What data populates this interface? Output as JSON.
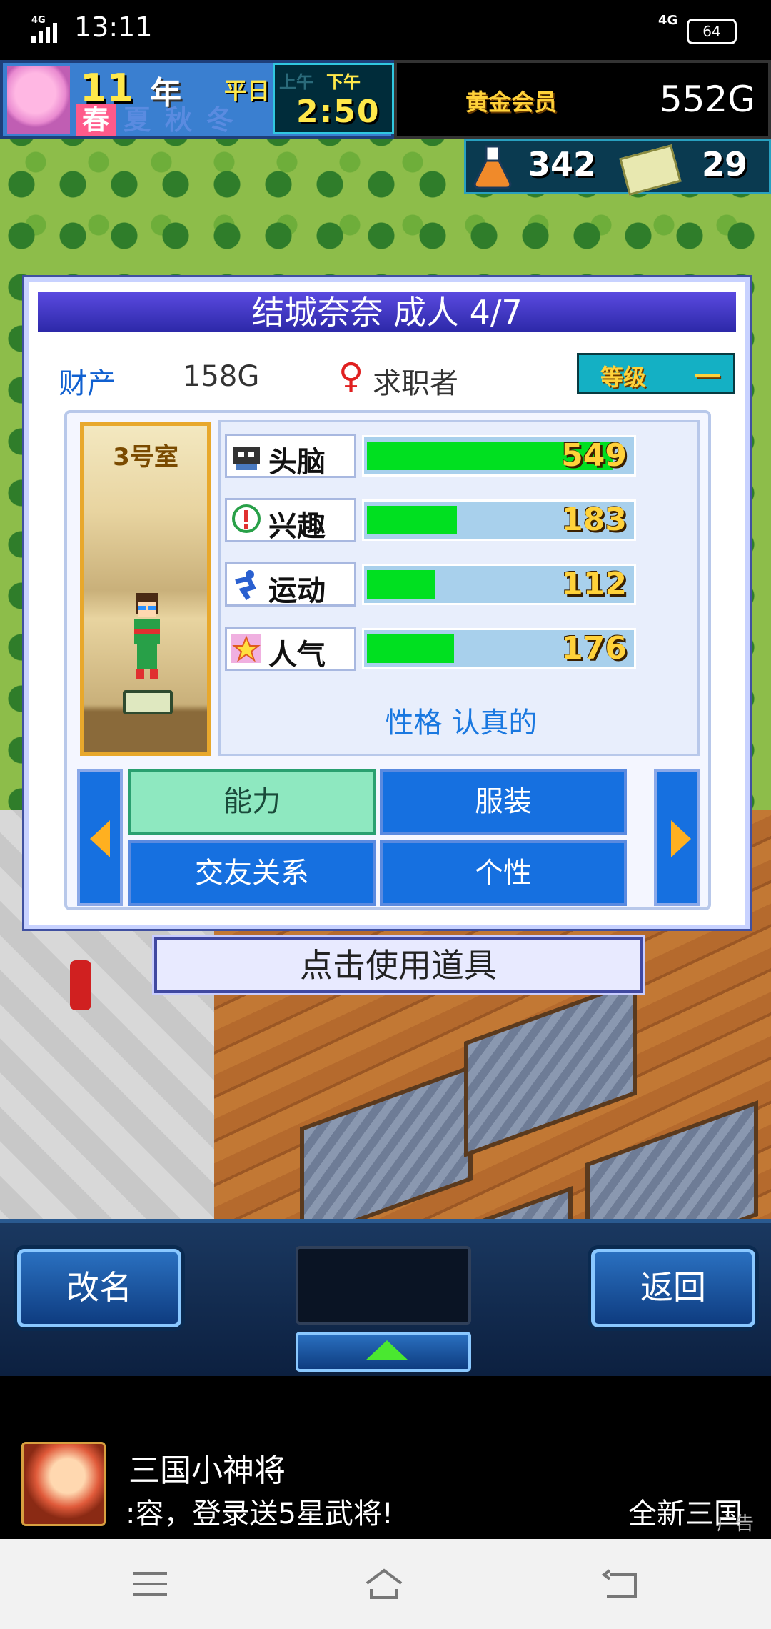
{
  "status_bar": {
    "time": "13:11",
    "network": "4G",
    "battery": "64"
  },
  "hud": {
    "year_number": "11",
    "year_label": "年",
    "day_type": "平日",
    "seasons": [
      {
        "label": "春",
        "active": true
      },
      {
        "label": "夏",
        "active": false
      },
      {
        "label": "秋",
        "active": false
      },
      {
        "label": "冬",
        "active": false
      }
    ],
    "am_label": "上午",
    "pm_label": "下午",
    "current_period": "下午",
    "time": "2:50",
    "membership": "黄金会员",
    "gold": "552G",
    "research_points": "342",
    "tickets": "29"
  },
  "dialog": {
    "title": "结城奈奈 成人 4/7",
    "wealth_label": "财产",
    "wealth_value": "158G",
    "gender_symbol": "♀",
    "job": "求职者",
    "rank_label": "等级",
    "rank_value": "一",
    "room": "3号室",
    "stats": [
      {
        "name": "头脑",
        "value": "549",
        "fill": 0.93,
        "icon": "brain-icon"
      },
      {
        "name": "兴趣",
        "value": "183",
        "fill": 0.34,
        "icon": "interest-icon"
      },
      {
        "name": "运动",
        "value": "112",
        "fill": 0.26,
        "icon": "sports-icon"
      },
      {
        "name": "人气",
        "value": "176",
        "fill": 0.33,
        "icon": "popularity-icon"
      }
    ],
    "personality": "性格 认真的",
    "tabs": [
      "能力",
      "服装",
      "交友关系",
      "个性"
    ],
    "active_tab": "能力"
  },
  "use_item": "点击使用道具",
  "panel": {
    "rename": "改名",
    "back": "返回"
  },
  "ad": {
    "title": "三国小神将",
    "text": ":容，登录送5星武将!",
    "new_text": "全新三国",
    "tag": "广告"
  }
}
